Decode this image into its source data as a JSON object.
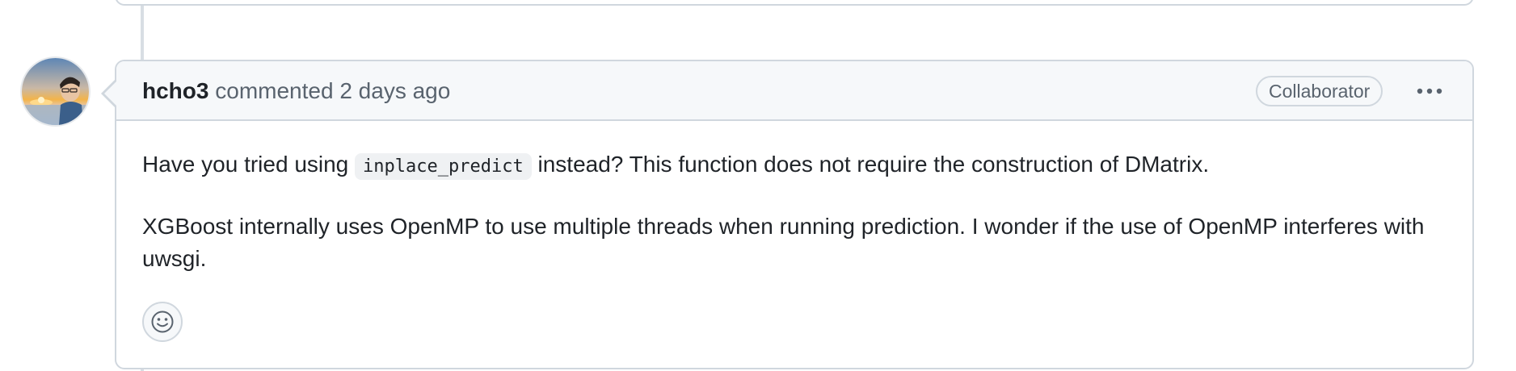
{
  "comment": {
    "author": "hcho3",
    "action": "commented",
    "timestamp": "2 days ago",
    "role_badge": "Collaborator",
    "body": {
      "p1_before": "Have you tried using ",
      "p1_code": "inplace_predict",
      "p1_after": " instead? This function does not require the construction of DMatrix.",
      "p2": "XGBoost internally uses OpenMP to use multiple threads when running prediction. I wonder if the use of OpenMP interferes with uwsgi."
    }
  },
  "icons": {
    "more_options": "kebab-horizontal-icon",
    "add_reaction": "smiley-icon"
  },
  "colors": {
    "border": "#d0d7de",
    "header_bg": "#f6f8fa",
    "text": "#1f2328",
    "muted": "#59636e"
  }
}
